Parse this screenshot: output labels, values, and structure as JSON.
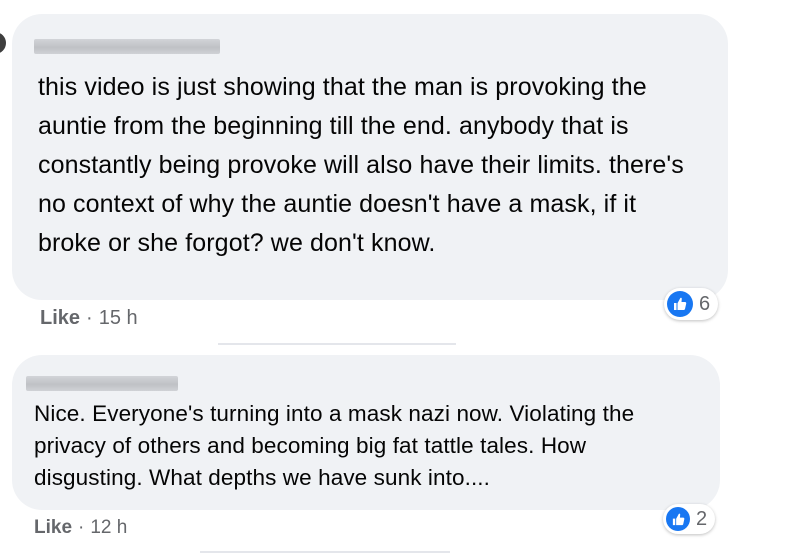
{
  "comments": [
    {
      "text": "this video is just showing that the man is provoking the auntie from the beginning till the end. anybody that is constantly being provoke will also have their limits. there's no context of why the auntie doesn't have a mask, if it broke or she forgot? we don't know.",
      "like_label": "Like",
      "separator": "·",
      "time": "15 h",
      "reaction_count": "6"
    },
    {
      "text": "Nice. Everyone's turning into a mask nazi now. Violating the privacy of others and becoming big fat tattle tales. How disgusting. What depths we have sunk into....",
      "like_label": "Like",
      "separator": "·",
      "time": "12 h",
      "reaction_count": "2"
    }
  ],
  "colors": {
    "bubble": "#f0f2f5",
    "like_blue": "#1877f2",
    "meta_text": "#65676b"
  },
  "icons": {
    "reaction": "thumbs-up-icon"
  }
}
